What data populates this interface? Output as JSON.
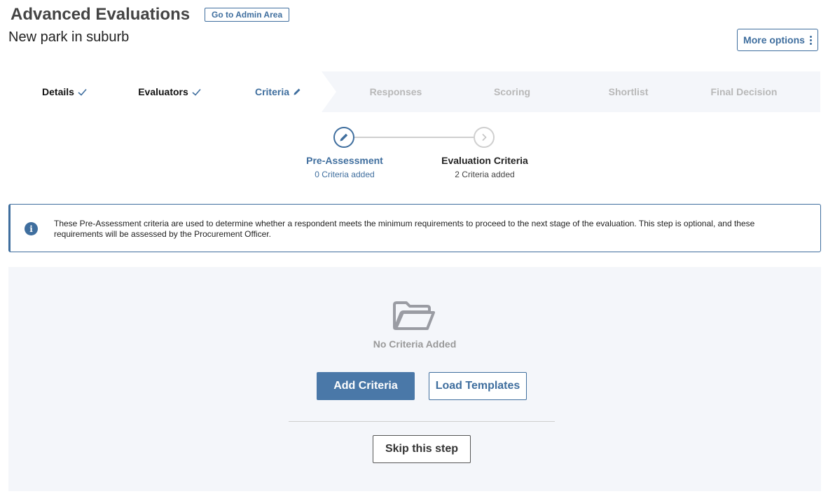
{
  "header": {
    "title": "Advanced Evaluations",
    "admin_button": "Go to Admin Area",
    "subtitle": "New park in suburb",
    "more_options": "More options"
  },
  "steps": [
    {
      "label": "Details",
      "state": "done",
      "icon": "check-icon"
    },
    {
      "label": "Evaluators",
      "state": "done",
      "icon": "check-icon"
    },
    {
      "label": "Criteria",
      "state": "current",
      "icon": "pencil-icon"
    },
    {
      "label": "Responses",
      "state": "todo"
    },
    {
      "label": "Scoring",
      "state": "todo"
    },
    {
      "label": "Shortlist",
      "state": "todo"
    },
    {
      "label": "Final Decision",
      "state": "todo"
    }
  ],
  "substeps": [
    {
      "label": "Pre-Assessment",
      "count": "0 Criteria added",
      "state": "active",
      "icon": "pencil-icon"
    },
    {
      "label": "Evaluation Criteria",
      "count": "2 Criteria added",
      "state": "next",
      "icon": "chevron-right-icon"
    }
  ],
  "info": {
    "icon": "info-icon",
    "text": "These Pre-Assessment criteria are used to determine whether a respondent meets the minimum requirements to proceed to the next stage of the evaluation. This step is optional, and these requirements will be assessed by the Procurement Officer."
  },
  "empty_state": {
    "icon": "open-folder-icon",
    "message": "No Criteria Added",
    "add_button": "Add Criteria",
    "load_button": "Load Templates",
    "skip_button": "Skip this step"
  },
  "colors": {
    "accent": "#3f6e9e",
    "button_fill": "#4a78a8",
    "step_done_bg": "#ffffff",
    "step_todo_bg": "#f4f6fa",
    "panel_bg": "#f4f6fa",
    "muted_text": "#b8b8b8"
  }
}
